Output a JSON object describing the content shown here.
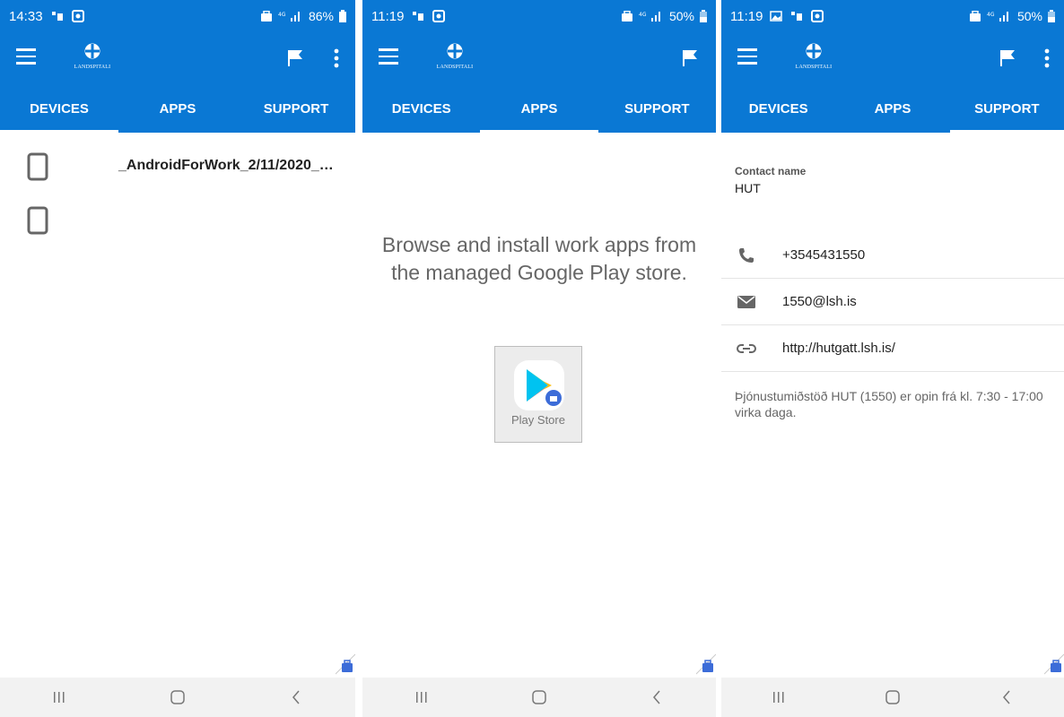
{
  "colors": {
    "accent": "#0a78d4",
    "status_bar_text": "#ffffff"
  },
  "screens": [
    {
      "status": {
        "time": "14:33",
        "battery": "86%"
      },
      "tabs": [
        "DEVICES",
        "APPS",
        "SUPPORT"
      ],
      "active_tab": "DEVICES",
      "devices": [
        {
          "name": "_AndroidForWork_2/11/2020_…",
          "icon": "phone-icon"
        },
        {
          "name": "",
          "icon": "phone-icon"
        }
      ]
    },
    {
      "status": {
        "time": "11:19",
        "battery": "50%"
      },
      "tabs": [
        "DEVICES",
        "APPS",
        "SUPPORT"
      ],
      "active_tab": "APPS",
      "message": "Browse and install work apps from the managed Google Play store.",
      "app_tile": {
        "label": "Play Store",
        "icon": "play-store-icon"
      }
    },
    {
      "status": {
        "time": "11:19",
        "battery": "50%"
      },
      "tabs": [
        "DEVICES",
        "APPS",
        "SUPPORT"
      ],
      "active_tab": "SUPPORT",
      "contact_label": "Contact name",
      "contact_name": "HUT",
      "phone": "+3545431550",
      "email": "1550@lsh.is",
      "website": "http://hutgatt.lsh.is/",
      "hours": "Þjónustumiðstöð HUT (1550) er opin frá kl. 7:30 - 17:00 virka daga."
    }
  ],
  "app": {
    "logo_text": "LANDSPITALI"
  }
}
